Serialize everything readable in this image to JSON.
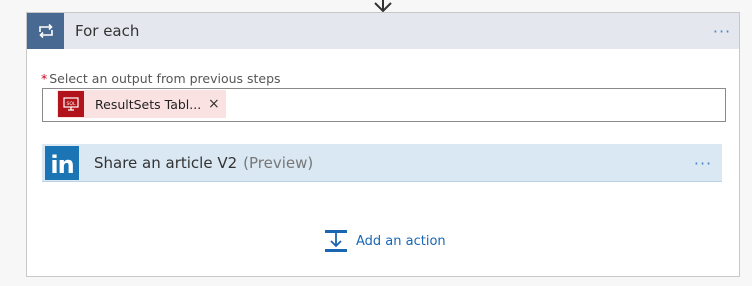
{
  "foreach": {
    "title": "For each",
    "more_label": "···",
    "icon": "loop-icon"
  },
  "select_output": {
    "required_mark": "*",
    "label": "Select an output from previous steps",
    "token": {
      "icon": "sql-icon",
      "label": "ResultSets Tabl...",
      "remove_label": "×"
    }
  },
  "action": {
    "title": "Share an article V2",
    "badge": "(Preview)",
    "logo_text": "in",
    "more_label": "···"
  },
  "add_action": {
    "label": "Add an action",
    "icon": "add-action-icon"
  },
  "colors": {
    "foreach_icon_bg": "#486991",
    "header_bg": "#e4e7ee",
    "sql_red": "#b1141b",
    "token_bg": "#fbe2e2",
    "linkedin_blue": "#1b75b4",
    "action_bg": "#d9e8f3",
    "link_blue": "#1a66b3"
  }
}
